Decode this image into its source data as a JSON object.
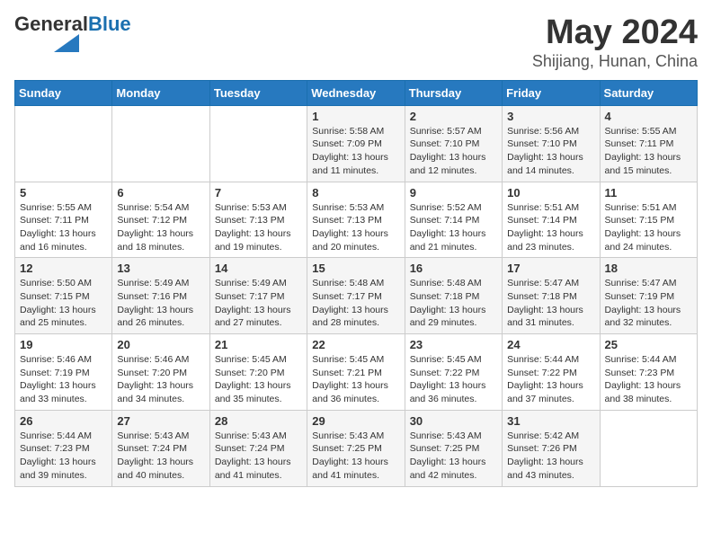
{
  "header": {
    "logo_general": "General",
    "logo_blue": "Blue",
    "month": "May 2024",
    "location": "Shijiang, Hunan, China"
  },
  "weekdays": [
    "Sunday",
    "Monday",
    "Tuesday",
    "Wednesday",
    "Thursday",
    "Friday",
    "Saturday"
  ],
  "weeks": [
    [
      {
        "day": "",
        "info": ""
      },
      {
        "day": "",
        "info": ""
      },
      {
        "day": "",
        "info": ""
      },
      {
        "day": "1",
        "info": "Sunrise: 5:58 AM\nSunset: 7:09 PM\nDaylight: 13 hours\nand 11 minutes."
      },
      {
        "day": "2",
        "info": "Sunrise: 5:57 AM\nSunset: 7:10 PM\nDaylight: 13 hours\nand 12 minutes."
      },
      {
        "day": "3",
        "info": "Sunrise: 5:56 AM\nSunset: 7:10 PM\nDaylight: 13 hours\nand 14 minutes."
      },
      {
        "day": "4",
        "info": "Sunrise: 5:55 AM\nSunset: 7:11 PM\nDaylight: 13 hours\nand 15 minutes."
      }
    ],
    [
      {
        "day": "5",
        "info": "Sunrise: 5:55 AM\nSunset: 7:11 PM\nDaylight: 13 hours\nand 16 minutes."
      },
      {
        "day": "6",
        "info": "Sunrise: 5:54 AM\nSunset: 7:12 PM\nDaylight: 13 hours\nand 18 minutes."
      },
      {
        "day": "7",
        "info": "Sunrise: 5:53 AM\nSunset: 7:13 PM\nDaylight: 13 hours\nand 19 minutes."
      },
      {
        "day": "8",
        "info": "Sunrise: 5:53 AM\nSunset: 7:13 PM\nDaylight: 13 hours\nand 20 minutes."
      },
      {
        "day": "9",
        "info": "Sunrise: 5:52 AM\nSunset: 7:14 PM\nDaylight: 13 hours\nand 21 minutes."
      },
      {
        "day": "10",
        "info": "Sunrise: 5:51 AM\nSunset: 7:14 PM\nDaylight: 13 hours\nand 23 minutes."
      },
      {
        "day": "11",
        "info": "Sunrise: 5:51 AM\nSunset: 7:15 PM\nDaylight: 13 hours\nand 24 minutes."
      }
    ],
    [
      {
        "day": "12",
        "info": "Sunrise: 5:50 AM\nSunset: 7:15 PM\nDaylight: 13 hours\nand 25 minutes."
      },
      {
        "day": "13",
        "info": "Sunrise: 5:49 AM\nSunset: 7:16 PM\nDaylight: 13 hours\nand 26 minutes."
      },
      {
        "day": "14",
        "info": "Sunrise: 5:49 AM\nSunset: 7:17 PM\nDaylight: 13 hours\nand 27 minutes."
      },
      {
        "day": "15",
        "info": "Sunrise: 5:48 AM\nSunset: 7:17 PM\nDaylight: 13 hours\nand 28 minutes."
      },
      {
        "day": "16",
        "info": "Sunrise: 5:48 AM\nSunset: 7:18 PM\nDaylight: 13 hours\nand 29 minutes."
      },
      {
        "day": "17",
        "info": "Sunrise: 5:47 AM\nSunset: 7:18 PM\nDaylight: 13 hours\nand 31 minutes."
      },
      {
        "day": "18",
        "info": "Sunrise: 5:47 AM\nSunset: 7:19 PM\nDaylight: 13 hours\nand 32 minutes."
      }
    ],
    [
      {
        "day": "19",
        "info": "Sunrise: 5:46 AM\nSunset: 7:19 PM\nDaylight: 13 hours\nand 33 minutes."
      },
      {
        "day": "20",
        "info": "Sunrise: 5:46 AM\nSunset: 7:20 PM\nDaylight: 13 hours\nand 34 minutes."
      },
      {
        "day": "21",
        "info": "Sunrise: 5:45 AM\nSunset: 7:20 PM\nDaylight: 13 hours\nand 35 minutes."
      },
      {
        "day": "22",
        "info": "Sunrise: 5:45 AM\nSunset: 7:21 PM\nDaylight: 13 hours\nand 36 minutes."
      },
      {
        "day": "23",
        "info": "Sunrise: 5:45 AM\nSunset: 7:22 PM\nDaylight: 13 hours\nand 36 minutes."
      },
      {
        "day": "24",
        "info": "Sunrise: 5:44 AM\nSunset: 7:22 PM\nDaylight: 13 hours\nand 37 minutes."
      },
      {
        "day": "25",
        "info": "Sunrise: 5:44 AM\nSunset: 7:23 PM\nDaylight: 13 hours\nand 38 minutes."
      }
    ],
    [
      {
        "day": "26",
        "info": "Sunrise: 5:44 AM\nSunset: 7:23 PM\nDaylight: 13 hours\nand 39 minutes."
      },
      {
        "day": "27",
        "info": "Sunrise: 5:43 AM\nSunset: 7:24 PM\nDaylight: 13 hours\nand 40 minutes."
      },
      {
        "day": "28",
        "info": "Sunrise: 5:43 AM\nSunset: 7:24 PM\nDaylight: 13 hours\nand 41 minutes."
      },
      {
        "day": "29",
        "info": "Sunrise: 5:43 AM\nSunset: 7:25 PM\nDaylight: 13 hours\nand 41 minutes."
      },
      {
        "day": "30",
        "info": "Sunrise: 5:43 AM\nSunset: 7:25 PM\nDaylight: 13 hours\nand 42 minutes."
      },
      {
        "day": "31",
        "info": "Sunrise: 5:42 AM\nSunset: 7:26 PM\nDaylight: 13 hours\nand 43 minutes."
      },
      {
        "day": "",
        "info": ""
      }
    ]
  ]
}
